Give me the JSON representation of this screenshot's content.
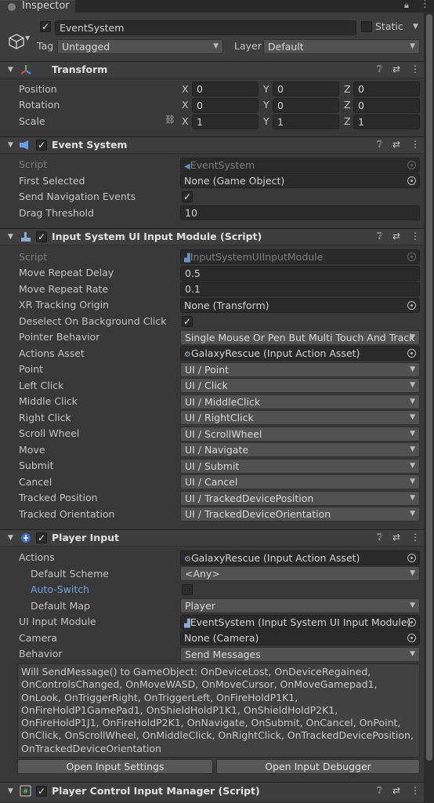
{
  "tab": {
    "title": "Inspector"
  },
  "gameobject": {
    "name": "EventSystem",
    "static_label": "Static",
    "tag_label": "Tag",
    "tag_value": "Untagged",
    "layer_label": "Layer",
    "layer_value": "Default",
    "active": true
  },
  "transform": {
    "title": "Transform",
    "rows": [
      {
        "label": "Position",
        "x": "0",
        "y": "0",
        "z": "0"
      },
      {
        "label": "Rotation",
        "x": "0",
        "y": "0",
        "z": "0"
      },
      {
        "label": "Scale",
        "x": "1",
        "y": "1",
        "z": "1"
      }
    ],
    "axes": [
      "X",
      "Y",
      "Z"
    ]
  },
  "event_system": {
    "title": "Event System",
    "script_label": "Script",
    "script_value": "EventSystem",
    "first_selected_label": "First Selected",
    "first_selected_value": "None (Game Object)",
    "send_nav_label": "Send Navigation Events",
    "send_nav_checked": true,
    "drag_threshold_label": "Drag Threshold",
    "drag_threshold_value": "10"
  },
  "input_module": {
    "title": "Input System UI Input Module (Script)",
    "script_label": "Script",
    "script_value": "InputSystemUIInputModule",
    "move_repeat_delay_label": "Move Repeat Delay",
    "move_repeat_delay_value": "0.5",
    "move_repeat_rate_label": "Move Repeat Rate",
    "move_repeat_rate_value": "0.1",
    "xr_origin_label": "XR Tracking Origin",
    "xr_origin_value": "None (Transform)",
    "deselect_label": "Deselect On Background Click",
    "deselect_checked": true,
    "pointer_behavior_label": "Pointer Behavior",
    "pointer_behavior_value": "Single Mouse Or Pen But Multi Touch And Track",
    "actions_asset_label": "Actions Asset",
    "actions_asset_value": "GalaxyRescue (Input Action Asset)",
    "actions": [
      {
        "label": "Point",
        "value": "UI / Point"
      },
      {
        "label": "Left Click",
        "value": "UI / Click"
      },
      {
        "label": "Middle Click",
        "value": "UI / MiddleClick"
      },
      {
        "label": "Right Click",
        "value": "UI / RightClick"
      },
      {
        "label": "Scroll Wheel",
        "value": "UI / ScrollWheel"
      },
      {
        "label": "Move",
        "value": "UI / Navigate"
      },
      {
        "label": "Submit",
        "value": "UI / Submit"
      },
      {
        "label": "Cancel",
        "value": "UI / Cancel"
      },
      {
        "label": "Tracked Position",
        "value": "UI / TrackedDevicePosition"
      },
      {
        "label": "Tracked Orientation",
        "value": "UI / TrackedDeviceOrientation"
      }
    ]
  },
  "player_input": {
    "title": "Player Input",
    "actions_label": "Actions",
    "actions_value": "GalaxyRescue (Input Action Asset)",
    "default_scheme_label": "Default Scheme",
    "default_scheme_value": "<Any>",
    "auto_switch_label": "Auto-Switch",
    "auto_switch_checked": false,
    "default_map_label": "Default Map",
    "default_map_value": "Player",
    "ui_module_label": "UI Input Module",
    "ui_module_value": "EventSystem (Input System UI Input Module)",
    "camera_label": "Camera",
    "camera_value": "None (Camera)",
    "behavior_label": "Behavior",
    "behavior_value": "Send Messages",
    "help_text": "Will SendMessage() to GameObject: OnDeviceLost, OnDeviceRegained, OnControlsChanged, OnMoveWASD, OnMoveCursor, OnMoveGamepad1, OnLook, OnTriggerRight, OnTriggerLeft, OnFireHoldP1K1, OnFireHoldP1GamePad1, OnShieldHoldP1K1, OnShieldHoldP2K1, OnFireHoldP1J1, OnFireHoldP2K1, OnNavigate, OnSubmit, OnCancel, OnPoint, OnClick, OnScrollWheel, OnMiddleClick, OnRightClick, OnTrackedDevicePosition, OnTrackedDeviceOrientation",
    "open_settings_label": "Open Input Settings",
    "open_debugger_label": "Open Input Debugger"
  },
  "player_control": {
    "title": "Player Control Input Manager (Script)"
  },
  "icons": {
    "help": "?",
    "presets": "⇄",
    "menu": "⋮",
    "check": "✓",
    "arrow": "▾",
    "fold": "▼"
  },
  "colors": {
    "background": "#383838",
    "header": "#3e3e3e",
    "field": "#2a2a2a",
    "dropdown": "#515151",
    "accent_blue": "#6fa2e0"
  }
}
